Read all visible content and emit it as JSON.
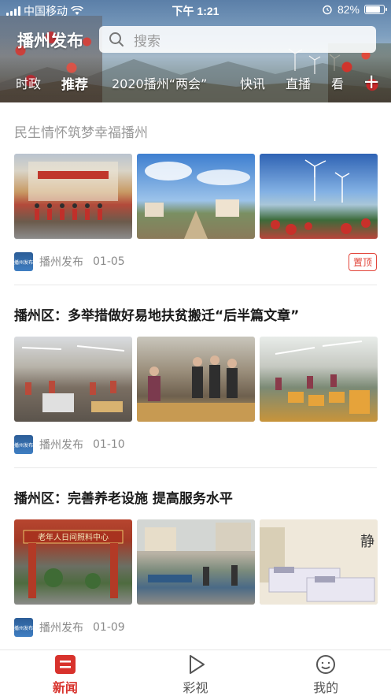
{
  "status_bar": {
    "carrier": "中国移动",
    "time": "下午 1:21",
    "battery": "82%",
    "battery_level": 0.82
  },
  "header": {
    "app_title": "播州发布",
    "search_placeholder": "搜索",
    "tabs": [
      "时政",
      "推荐",
      "2020播州“两会”",
      "快讯",
      "直播",
      "看"
    ],
    "active_tab": "推荐",
    "add_label": "+"
  },
  "feed": [
    {
      "title": "民生情怀筑梦幸福播州",
      "source": "播州发布",
      "date": "01-05",
      "badge": "置顶"
    },
    {
      "title": "播州区：多举措做好易地扶贫搬迁“后半篇文章”",
      "source": "播州发布",
      "date": "01-10"
    },
    {
      "title": "播州区：完善养老设施 提高服务水平",
      "source": "播州发布",
      "date": "01-09",
      "gate_sign": "老年人日间照料中心",
      "wall_character": "静"
    }
  ],
  "source_logo_text": "播州发布",
  "bottom_nav": [
    {
      "label": "新闻",
      "icon": "news-icon",
      "active": true
    },
    {
      "label": "彩视",
      "icon": "play-icon",
      "active": false
    },
    {
      "label": "我的",
      "icon": "profile-icon",
      "active": false
    }
  ],
  "colors": {
    "accent": "#d8322c",
    "pin_border": "#e2453a"
  }
}
